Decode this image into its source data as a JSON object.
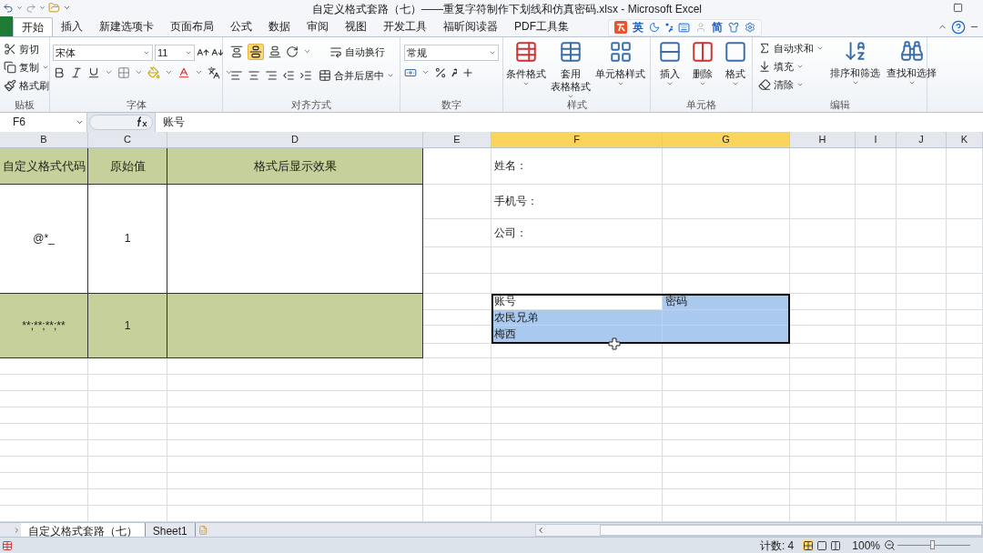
{
  "window": {
    "title": "自定义格式套路（七）——重复字符制作下划线和仿真密码.xlsx - Microsoft Excel"
  },
  "tabs": [
    {
      "label": "开始",
      "selected": true
    },
    {
      "label": "插入",
      "selected": false
    },
    {
      "label": "新建选项卡",
      "selected": false
    },
    {
      "label": "页面布局",
      "selected": false
    },
    {
      "label": "公式",
      "selected": false
    },
    {
      "label": "数据",
      "selected": false
    },
    {
      "label": "审阅",
      "selected": false
    },
    {
      "label": "视图",
      "selected": false
    },
    {
      "label": "开发工具",
      "selected": false
    },
    {
      "label": "福昕阅读器",
      "selected": false
    },
    {
      "label": "PDF工具集",
      "selected": false
    }
  ],
  "ime_bar": {
    "mode": "英",
    "script": "简"
  },
  "ribbon": {
    "groups": [
      {
        "kind": "clipboard",
        "label": "贴板",
        "items": [
          "剪切",
          "复制",
          "格式刷"
        ]
      },
      {
        "kind": "font",
        "label": "字体",
        "font": "宋体",
        "size": "11"
      },
      {
        "kind": "alignment",
        "label": "对齐方式",
        "items": [
          "自动换行",
          "合并后居中"
        ]
      },
      {
        "kind": "number",
        "label": "数字",
        "format": "常规"
      },
      {
        "kind": "styles",
        "label": "样式",
        "items": [
          {
            "lines": [
              "条件格式"
            ]
          },
          {
            "lines": [
              "套用",
              "表格格式"
            ]
          },
          {
            "lines": [
              "单元格样式"
            ]
          }
        ]
      },
      {
        "kind": "cells",
        "label": "单元格",
        "items": [
          "插入",
          "删除",
          "格式"
        ]
      },
      {
        "kind": "editing",
        "label": "编辑",
        "items": [
          "自动求和",
          "填充",
          "清除"
        ],
        "big_items": [
          "排序和筛选",
          "查找和选择"
        ]
      }
    ]
  },
  "formula_bar": {
    "name_box": "F6",
    "formula": "账号"
  },
  "columns": [
    {
      "label": "B",
      "selected": false
    },
    {
      "label": "C",
      "selected": false
    },
    {
      "label": "D",
      "selected": false
    },
    {
      "label": "E",
      "selected": false
    },
    {
      "label": "F",
      "selected": true
    },
    {
      "label": "G",
      "selected": true
    },
    {
      "label": "H",
      "selected": false
    },
    {
      "label": "I",
      "selected": false
    },
    {
      "label": "J",
      "selected": false
    },
    {
      "label": "K",
      "selected": false
    }
  ],
  "format_table": {
    "headers": [
      "自定义格式代码",
      "原始值",
      "格式后显示效果"
    ],
    "rows": [
      {
        "code": "@*_",
        "original": "1"
      },
      {
        "code": "**;**;**;**",
        "original": "1"
      }
    ]
  },
  "form_labels": [
    "姓名：",
    "手机号：",
    "公司："
  ],
  "selection": {
    "rows": [
      [
        {
          "text": "账号",
          "highlighted": false
        },
        {
          "text": "密码",
          "highlighted": true
        }
      ],
      [
        {
          "text": "农民兄弟",
          "highlighted": true
        },
        {
          "highlighted": true
        }
      ],
      [
        {
          "text": "梅西",
          "highlighted": true
        },
        {
          "highlighted": true
        }
      ]
    ]
  },
  "sheets": [
    {
      "label": "自定义格式套路（七）",
      "selected": true
    },
    {
      "label": "Sheet1",
      "selected": false
    }
  ],
  "status_bar": {
    "count": "计数: 4",
    "zoom": "100%"
  }
}
